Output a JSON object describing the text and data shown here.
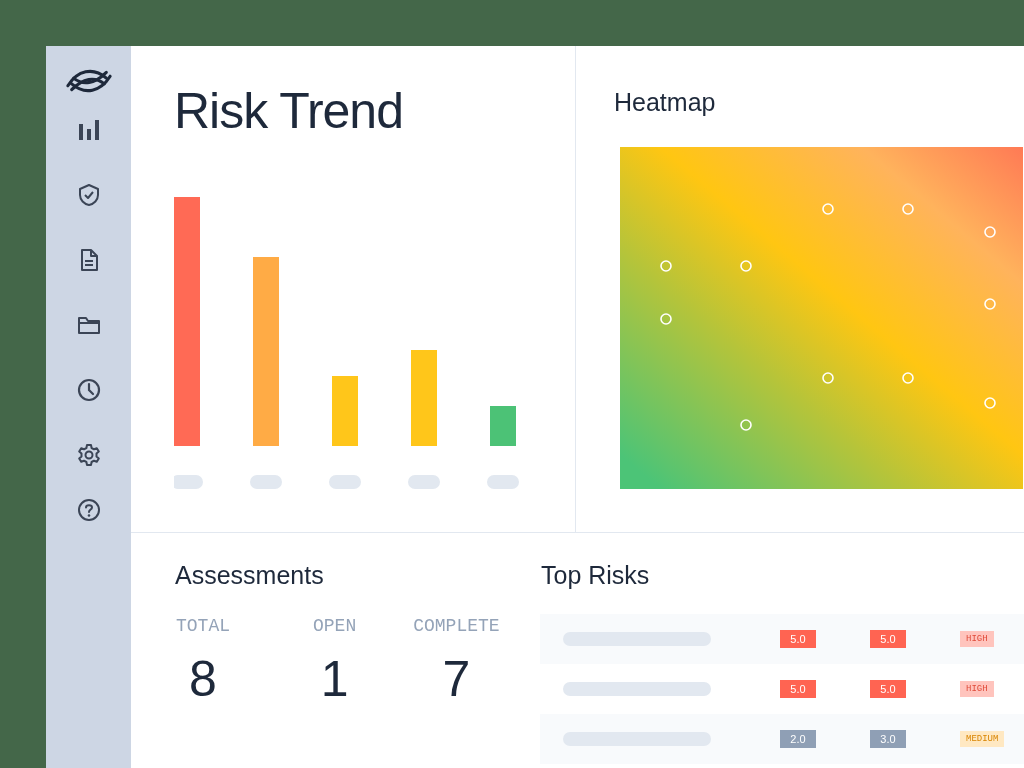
{
  "trend": {
    "title": "Risk Trend"
  },
  "heatmap": {
    "title": "Heatmap"
  },
  "assessments": {
    "title": "Assessments",
    "stats": [
      {
        "label": "TOTAL",
        "value": "8"
      },
      {
        "label": "OPEN",
        "value": "1"
      },
      {
        "label": "COMPLETE",
        "value": "7"
      }
    ]
  },
  "top_risks": {
    "title": "Top Risks",
    "rows": [
      {
        "scores": [
          {
            "text": "5.0",
            "color": "#ff6452"
          },
          {
            "text": "5.0",
            "color": "#ff6452"
          }
        ],
        "rating": {
          "text": "HIGH",
          "kind": "high"
        }
      },
      {
        "scores": [
          {
            "text": "5.0",
            "color": "#ff6452"
          },
          {
            "text": "5.0",
            "color": "#ff6452"
          }
        ],
        "rating": {
          "text": "HIGH",
          "kind": "high"
        }
      },
      {
        "scores": [
          {
            "text": "2.0",
            "color": "#8f9fb5"
          },
          {
            "text": "3.0",
            "color": "#8f9fb5"
          }
        ],
        "rating": {
          "text": "MEDIUM",
          "kind": "medium"
        }
      }
    ]
  }
}
